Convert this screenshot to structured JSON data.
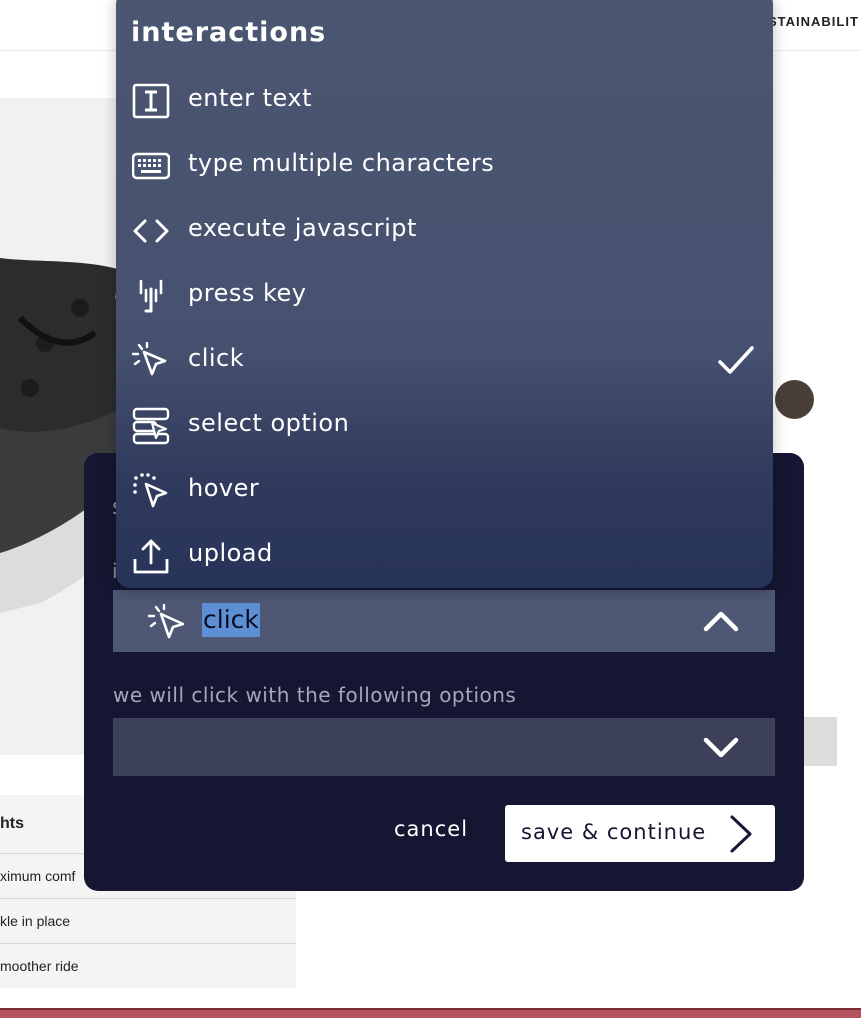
{
  "background_page": {
    "nav_link": "STAINABILIT",
    "features": {
      "header": "hts",
      "rows": [
        "ximum comf",
        "kle in place",
        "moother ride"
      ]
    }
  },
  "dropdown": {
    "title": "interactions",
    "items": [
      {
        "label": "enter text",
        "icon": "text-cursor-icon"
      },
      {
        "label": "type multiple characters",
        "icon": "keyboard-icon"
      },
      {
        "label": "execute javascript",
        "icon": "code-brackets-icon"
      },
      {
        "label": "press key",
        "icon": "key-press-icon"
      },
      {
        "label": "click",
        "icon": "cursor-click-icon",
        "selected": true
      },
      {
        "label": "select option",
        "icon": "select-option-icon"
      },
      {
        "label": "hover",
        "icon": "cursor-hover-icon"
      },
      {
        "label": "upload",
        "icon": "upload-icon"
      }
    ]
  },
  "modal": {
    "partial_heading": "s",
    "partial_label": "i",
    "interaction_select": {
      "value": "click",
      "icon": "cursor-click-icon"
    },
    "options_label": "we will click with the following options",
    "options_select": {
      "value": ""
    },
    "cancel_label": "cancel",
    "save_label": "save & continue"
  },
  "colors": {
    "modal_bg": "#151631",
    "dropdown_bg": "#4b5671",
    "selected_text_highlight": "#5c8fd4",
    "accent_bar": "#b5535e"
  }
}
